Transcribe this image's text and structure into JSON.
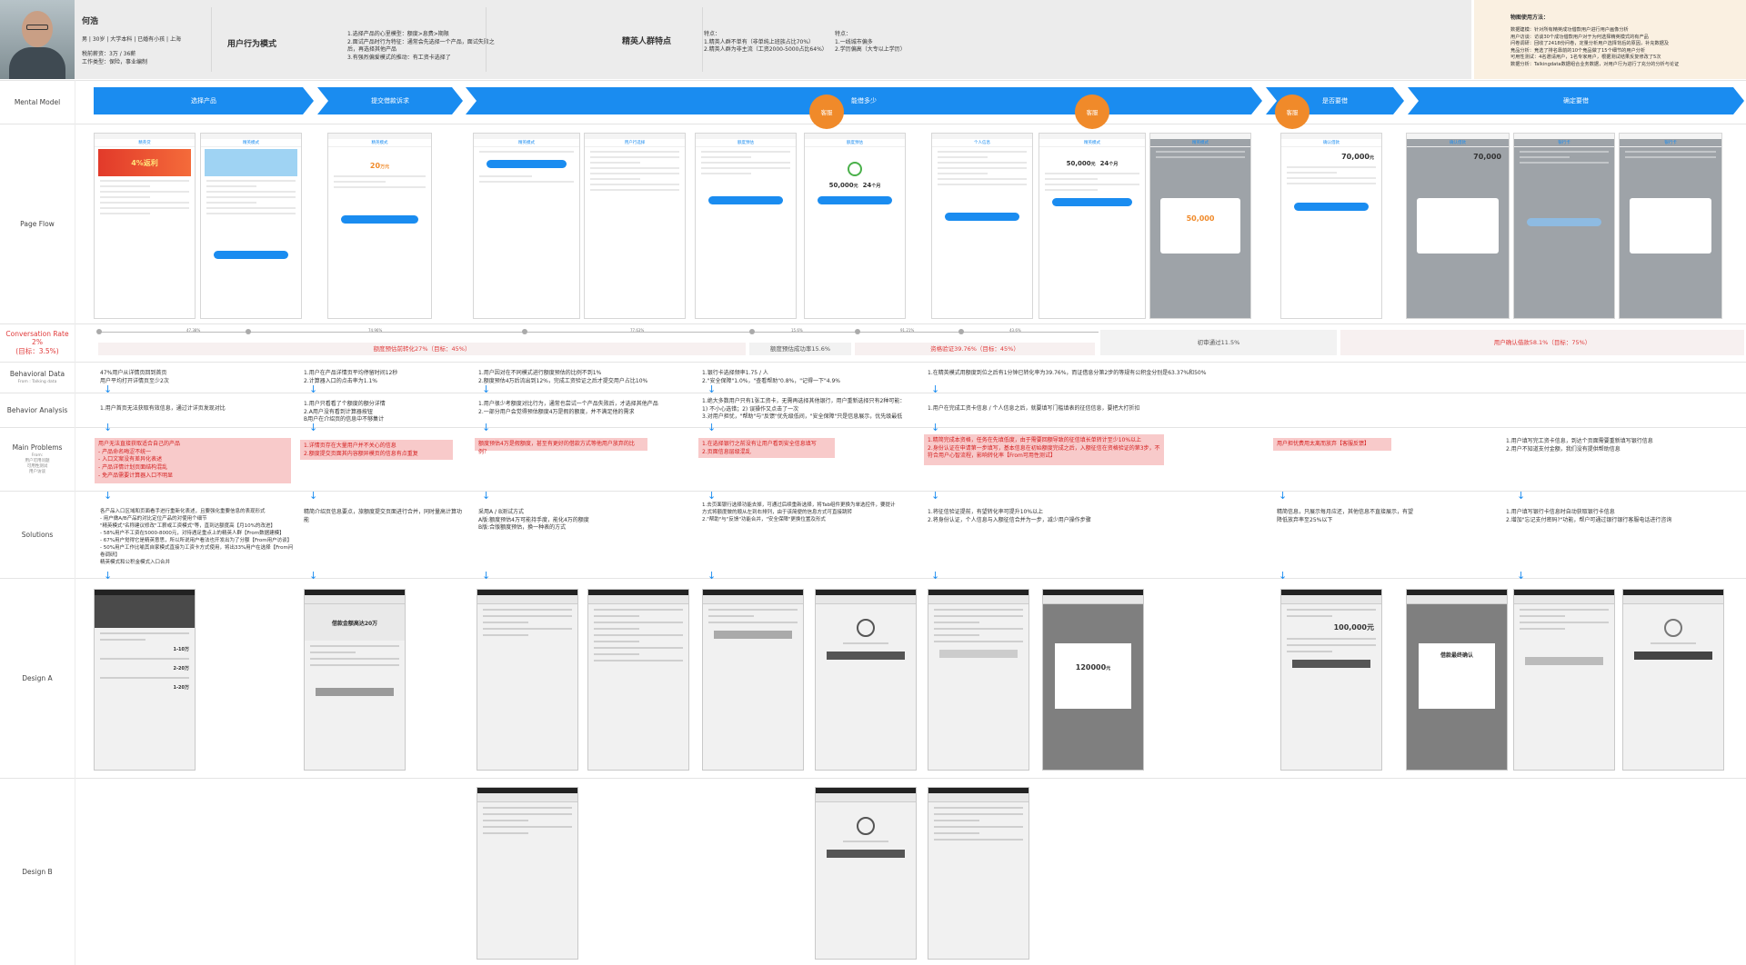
{
  "persona": {
    "name": "何浩",
    "info": "男 | 30岁 | 大学本科 | 已婚有小孩 | 上海",
    "income": "税前薪资：3万 / 36薪\n工作类型：保险，事业编制",
    "model_label": "用户行为模式",
    "model_text": "1.选择产品的心里模型：额度>息费>期限\n2.面试产品时行为特征：通常会先选择一个产品，面试失败之后，再选择其他产品\n3.有强烈偏爱模式的推动：有工资卡选择了",
    "traits_label": "精英人群特点",
    "trait1": "特点：\n1.精英人群不单有（非单纯上班族占比70%）\n2.精英人群为非主流（工资2000-5000占比64%）",
    "trait2": "特点：\n1.一线城市偏多\n2.学历偏高（大专以上学历）",
    "method_title": "物图使用方法：",
    "method_text": "数据建模：针对所有精英成功借款用户进行用户画像分析\n用户访谈：访谈30个成功借款用户对于为何选择精英模式的有产品\n问卷调研：回收了2418份问卷，定量分析用户选择背后的原因，补充数据及\n竞品分析：竞选了排名靠前的10个竞品做了15个细节的用户分析\n可用性测试：4名邀请用户，1名专家用户，根据测试结果反复修改了5次\n数据分析：Talkingdata数据组合业务数据，对用户行为进行了充分的分析与论证"
  },
  "rows": {
    "mental": "Mental Model",
    "page_flow": "Page Flow",
    "conv": "Conversation Rate 2%",
    "conv_target": "(目标：3.5%)",
    "behavioral": "Behavioral Data",
    "behavioral_sub": "From : Talking data",
    "analysis": "Behavior Analysis",
    "problems": "Main Problems",
    "problems_sub": "From:\n用户可用问题\n可用性测试\n用户访谈",
    "solutions": "Solutions",
    "design_a": "Design A",
    "design_b": "Design B"
  },
  "mental": {
    "s1": "选择产品",
    "s2": "提交借款诉求",
    "s3": "能借多少",
    "s4": "是否要借",
    "s5": "确定要借",
    "kf": "客服"
  },
  "flow": {
    "banner": "4%返利",
    "amount": "20",
    "amount_unit": "万元",
    "quota": "50,000",
    "quota_unit": "元",
    "term": "24",
    "term_unit": "个月",
    "medal": "50,000",
    "big": "70,000",
    "big_unit": "元"
  },
  "conv": {
    "p1": "47.38%",
    "p2": "74.96%",
    "p3": "77.63%",
    "p4": "15.6%",
    "p5": "91.21%",
    "p6": "43.6%",
    "r1": "额度预估前转化27%（目标：45%）",
    "r2": "额度预估成功率15.6%",
    "r3": "资格验证39.76%（目标：45%）",
    "r4": "初审通过11.5%",
    "r5": "用户确认借款58.1%（目标：75%）"
  },
  "behavioral": {
    "c1": "47%用户从详情页回到首页\n用户平均打开详情页至少2次",
    "c2": "1.用户在产品详情页平均停留时间12秒\n2.计算器入口的点击率为1.1%",
    "c3": "1.用户因对在不同模式进行额度预估的比例不到1%\n2.额度预估4万后流出到12%，完成工资验证之后才提交用户占比10%",
    "c4": "1.银行卡选择频率1.75 / 人\n2.\"安全保障\"1.0%，\"查看帮助\"0.8%，\"记得一下\"4.9%",
    "c5": "1.在精英模式用额度到位之后有1分钟已转化率为39.76%，而证借息分第2步的等规有公积金分别是63.37%和50%"
  },
  "analysis": {
    "c1": "1.用户首页无法获取有效信息，通过计详页发现对比",
    "c2": "1.用户只看看了个额度的额分详情\n2.A用户没有看到计算器按钮\n  B用户在介绍页的信息中不够集计",
    "c3": "1.用户很少考额度对比行为，通常也尝试一个产品失败后，才选择其他产品\n2.一部分用户会觉得预估额度4万是假的额度，并不满足他的需求",
    "c4": "1.绝大多数用户只有1张工资卡，无需再选择其他银行，用户重新选择只有2种可能：\n1) 不小心选错；2) 误操作又点击了一次\n3.对用户担忧，\"帮助\"与\"反馈\"优先级低间，\"安全保障\"只是信息展示，优先级最低",
    "c5": "1.用户在完成工资卡信息 / 个人信息之后，就要填写门槛填表的征信信息，要把大打折扣"
  },
  "problems": {
    "c1": "用户无法直接获取适合自己的产品\n- 产品命名晦涩不统一\n- 入口文案没有差异化表述\n- 产品详情计划页面结构混乱\n- 免产品需要计算器入口不明显",
    "c2": "1.详情页存在大量用户并不关心的信息\n2.额度提交页面其内容额异模页的信息有点重复",
    "c3": "额度预估4万是假额度，甚至有更好的借款方式等他用户放弃的比例？",
    "c4": "1.在选择银行之前没有让用户看到安全信息填写\n2.页面信息层级混乱",
    "c5": "1.精简完成本资格，任务在先填低度，由于需要回额导致的征信填长单转计至少10%以上\n2.身份认证在申请第一步填写，基本信息在初始额度完成之后，入额征信在资格验证的第3步，不符合用户心智流程，影响转化率【From可用性测试】",
    "c6": "用户担忧费用太离而放弃【客服反馈】",
    "c7": "1.用户填写完工资卡信息，到达个页面需要重新填写银行信息\n2.用户不知道支付金额，我们没有提供帮助信息"
  },
  "solutions": {
    "c1": "各产品入口区域和页面看手进行重新化表述，且要强化重要信息的表现形式\n- 用户做A/B产品的对比定位产品的对使用个细节\n\"精英模式\"名称建议修改\"工薪或工资模式\"等，直到达额度高【月10%的改进】\n- 58%用户不工资在5000-8000元，对待遇足重点上的精英人群【From数据建模】\n- 67%用户觉得它是精英意思，所以所说用户看法也开发出为了分额【From用户访谈】\n- 50%用户工作比喻其自家模式直接为工资卡方式使用，将出33%用户在选择【From问卷调研】\n精英模式和公积金模式入口合并",
    "c2": "精简介绍页信息要点，旅额度提交页面进行合并，同时量高计算功能",
    "c3": "采用A / B测试方式\nA版:额度预估4万可能持手度，能化4万的额度\nB版:合版额度预估，换一种表的方式",
    "c4": "1.去页面银行选择功能去掉，可通过后续重新选择，将Tab组件更换为单选控件，要提计\n方式将额度做的顺从左到右排列，由于该简便的信息方式可直接跳转\n2.\"帮助\"与\"反馈\"功能合并，\"安全保障\"更换位置及形式",
    "c5": "1.将征信验证提前，有望转化率可提升10%以上\n2.将身份认证，个人信息与入额征信合并为一步，减少用户操作步骤",
    "c6": "精简信息，只展示每月应还，其他信息不直接展示，有望降低放弃率至25%以下",
    "c7": "1.用户填写银行卡信息时自动获取银行卡信息\n2.增加\"忘记支付密码?\"功能，帮户可通过银行银行客服电话进行咨询"
  },
  "design_a": {
    "amount_lbl": "借款金额高达20万",
    "m1": "1-10万",
    "m2": "2-20万",
    "m3": "1-20万",
    "medal": "120000",
    "medal_unit": "元",
    "big": "100,000元",
    "confirm": "借款最终确认"
  },
  "conv_positions": {
    "note": "rates shown on timeline"
  },
  "colors": {
    "accent": "#1a8cf0",
    "orange": "#f08a2a",
    "problem_bg": "#f8caca",
    "problem_text": "#d42020",
    "rate_red": "#e03a3a"
  }
}
